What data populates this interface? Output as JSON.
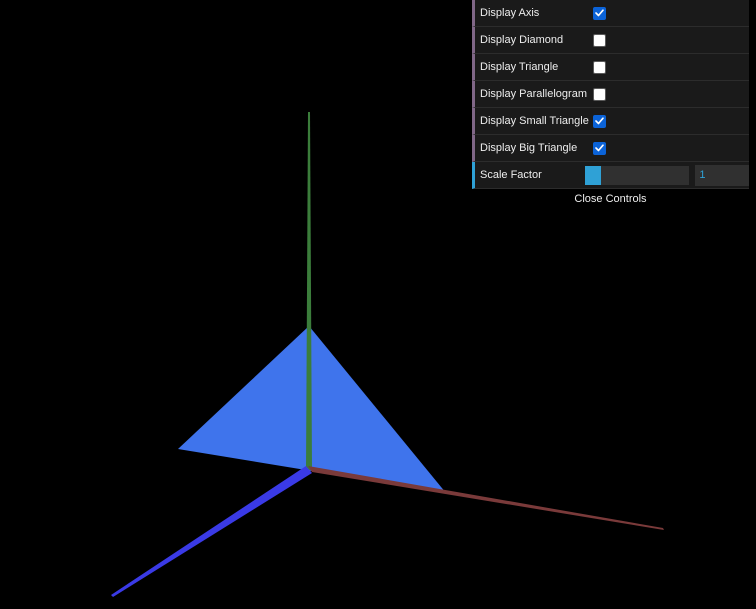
{
  "controls": {
    "items": [
      {
        "label": "Display Axis",
        "checked": true
      },
      {
        "label": "Display Diamond",
        "checked": false
      },
      {
        "label": "Display Triangle",
        "checked": false
      },
      {
        "label": "Display Parallelogram",
        "checked": false
      },
      {
        "label": "Display Small Triangle",
        "checked": true
      },
      {
        "label": "Display Big Triangle",
        "checked": true
      }
    ],
    "scale": {
      "label": "Scale Factor",
      "value": "1",
      "fraction": 0.15
    },
    "close_label": "Close Controls"
  },
  "scene": {
    "background": "#000000",
    "triangle_color": "#3f74ec",
    "axis_colors": {
      "x": "#7a3a3a",
      "y": "#3b7d3b",
      "z": "#3a3ae6"
    }
  }
}
